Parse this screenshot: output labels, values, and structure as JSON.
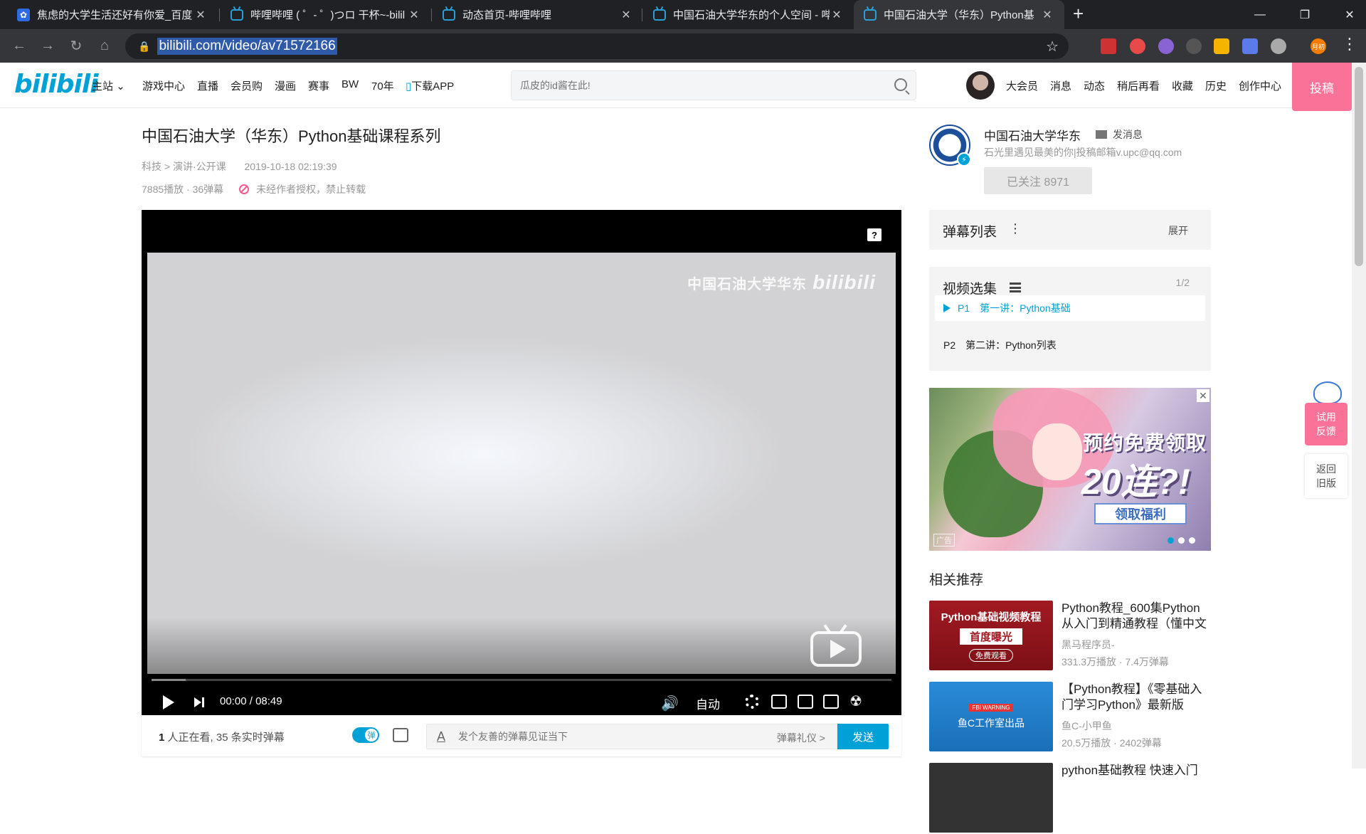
{
  "browser": {
    "tabs": [
      {
        "title": "焦虑的大学生活还好有你爱_百度",
        "icon": "baidu-paw-icon",
        "active": false
      },
      {
        "title": "哔哩哔哩 ( ゜- ゜)つロ 干杯~-bilil",
        "icon": "bilibili-tv-icon",
        "active": false
      },
      {
        "title": "动态首页-哔哩哔哩",
        "icon": "bilibili-tv-icon",
        "active": false
      },
      {
        "title": "中国石油大学华东的个人空间 - 哔",
        "icon": "bilibili-tv-icon",
        "active": false
      },
      {
        "title": "中国石油大学（华东）Python基",
        "icon": "bilibili-tv-icon",
        "active": true
      }
    ],
    "url": "bilibili.com/video/av71572166",
    "extension_badge": "月初"
  },
  "header": {
    "logo": "bilibili",
    "nav": [
      "主站",
      "游戏中心",
      "直播",
      "会员购",
      "漫画",
      "赛事",
      "BW",
      "70年",
      "下载APP"
    ],
    "search_placeholder": "瓜皮的id酱在此!",
    "user_links": [
      "大会员",
      "消息",
      "动态",
      "稍后再看",
      "收藏",
      "历史",
      "创作中心"
    ],
    "upload_label": "投稿"
  },
  "video": {
    "title": "中国石油大学（华东）Python基础课程系列",
    "category": "科技 > 演讲·公开课",
    "date": "2019-10-18 02:19:39",
    "stats": "7885播放 · 36弹幕",
    "copyright_notice": "未经作者授权，禁止转载"
  },
  "player": {
    "watermark_text": "中国石油大学华东",
    "watermark_logo": "bilibili",
    "current_time": "00:00",
    "separator": "/",
    "duration": "08:49",
    "quality": "自动",
    "buffer_fraction": 0.046
  },
  "danmaku_bar": {
    "viewers_count": "1",
    "viewers_text": " 人正在看,  ",
    "live_danmaku_count": "35",
    "live_danmaku_text": " 条实时弹幕",
    "toggle_label": "弹",
    "input_placeholder": "发个友善的弹幕见证当下",
    "etiquette_label": "弹幕礼仪 >",
    "send_label": "发送"
  },
  "uploader": {
    "name": "中国石油大学华东",
    "message_label": "发消息",
    "description": "石光里遇见最美的你|投稿邮箱v.upc@qq.com",
    "follow_label": "已关注 8971"
  },
  "danmaku_list": {
    "title": "弹幕列表",
    "expand_label": "展开"
  },
  "episodes": {
    "title": "视频选集",
    "count": "1/2",
    "items": [
      {
        "num": "P1",
        "title": "第一讲：Python基础",
        "active": true
      },
      {
        "num": "P2",
        "title": "第二讲：Python列表",
        "active": false
      }
    ]
  },
  "ad": {
    "line1": "预约免费领取",
    "line2": "20连?!",
    "cta": "领取福利",
    "label": "广告"
  },
  "recommendations": {
    "title": "相关推荐",
    "items": [
      {
        "title": "Python教程_600集Python从入门到精通教程（懂中文",
        "up": "黑马程序员-",
        "stats": "331.3万播放 · 7.4万弹幕",
        "thumb_lines": [
          "Python基础视频教程",
          "首度曝光",
          "免费观看"
        ]
      },
      {
        "title": "【Python教程】《零基础入门学习Python》最新版",
        "up": "鱼C-小甲鱼",
        "stats": "20.5万播放 · 2402弹幕",
        "thumb_lines": [
          "FBI WARNING",
          "鱼C工作室出品"
        ]
      },
      {
        "title": "python基础教程 快速入门"
      }
    ]
  },
  "side_buttons": {
    "feedback": "试用\n反馈",
    "old_version": "返回\n旧版"
  }
}
